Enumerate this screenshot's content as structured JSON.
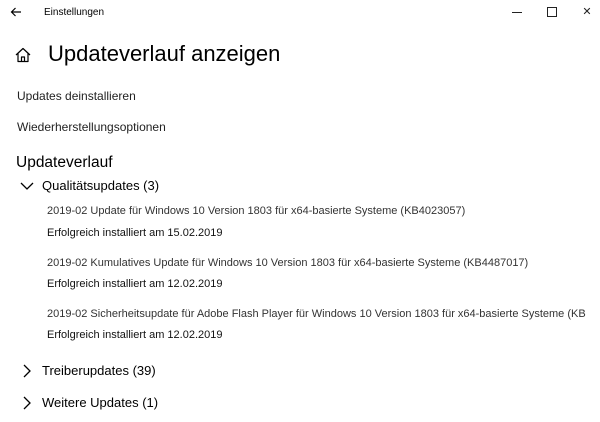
{
  "titlebar": {
    "app_title": "Einstellungen",
    "back_icon": "arrow-left-icon",
    "minimize_icon": "minimize-icon",
    "maximize_icon": "maximize-icon",
    "close_icon": "close-icon",
    "close_glyph": "✕"
  },
  "header": {
    "home_icon": "home-icon",
    "title": "Updateverlauf anzeigen"
  },
  "links": {
    "uninstall": "Updates deinstallieren",
    "recovery": "Wiederherstellungsoptionen"
  },
  "history": {
    "title": "Updateverlauf",
    "groups": [
      {
        "label": "Qualitätsupdates (3)",
        "expanded": true,
        "items": [
          {
            "name": "2019-02 Update für Windows 10 Version 1803 für x64-basierte Systeme (KB4023057)",
            "status": "Erfolgreich installiert am 15.02.2019"
          },
          {
            "name": "2019-02 Kumulatives Update für Windows 10 Version 1803 für x64-basierte Systeme (KB4487017)",
            "status": "Erfolgreich installiert am 12.02.2019"
          },
          {
            "name": "2019-02 Sicherheitsupdate für Adobe Flash Player für Windows 10 Version 1803 für x64-basierte Systeme (KB",
            "status": "Erfolgreich installiert am 12.02.2019"
          }
        ]
      },
      {
        "label": "Treiberupdates (39)",
        "expanded": false
      },
      {
        "label": "Weitere Updates (1)",
        "expanded": false
      }
    ]
  }
}
